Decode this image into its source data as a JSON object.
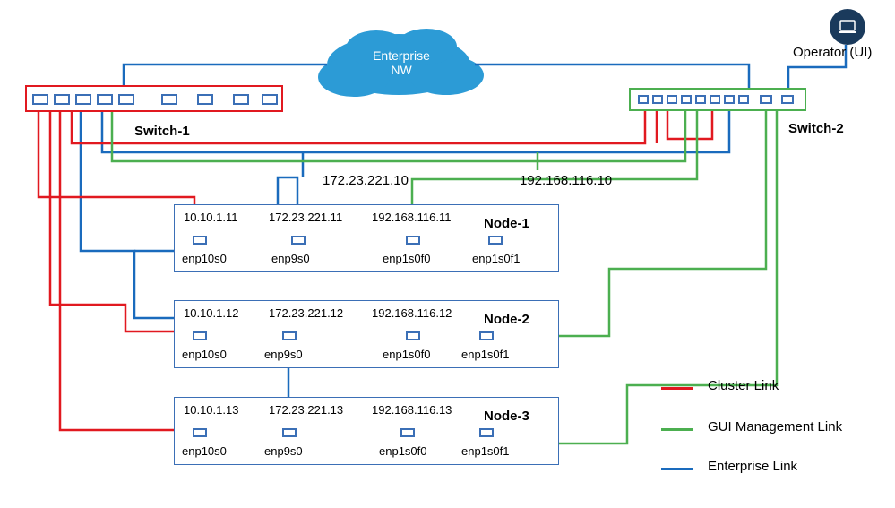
{
  "enterprise_nw_label": "Enterprise NW",
  "operator_label": "Operator (UI)",
  "switch1_label": "Switch-1",
  "switch2_label": "Switch-2",
  "vip_mgmt_ip": "172.23.221.10",
  "vip_gui_ip": "192.168.116.10",
  "nodes": [
    {
      "name": "Node-1",
      "cluster_ip": "10.10.1.11",
      "mgmt_ip": "172.23.221.11",
      "gui_ip": "192.168.116.11",
      "nics": [
        "enp10s0",
        "enp9s0",
        "enp1s0f0",
        "enp1s0f1"
      ]
    },
    {
      "name": "Node-2",
      "cluster_ip": "10.10.1.12",
      "mgmt_ip": "172.23.221.12",
      "gui_ip": "192.168.116.12",
      "nics": [
        "enp10s0",
        "enp9s0",
        "enp1s0f0",
        "enp1s0f1"
      ]
    },
    {
      "name": "Node-3",
      "cluster_ip": "10.10.1.13",
      "mgmt_ip": "172.23.221.13",
      "gui_ip": "192.168.116.13",
      "nics": [
        "enp10s0",
        "enp9s0",
        "enp1s0f0",
        "enp1s0f1"
      ]
    }
  ],
  "legend": {
    "cluster": "Cluster Link",
    "gui": "GUI Management Link",
    "ent": "Enterprise Link"
  },
  "colors": {
    "cluster": "#e11920",
    "gui": "#4caf50",
    "ent": "#1a6bbd",
    "cloud": "#2c9bd6",
    "switch1_border": "#e11920",
    "switch2_border": "#4caf50",
    "node_border": "#3b6fb6"
  }
}
